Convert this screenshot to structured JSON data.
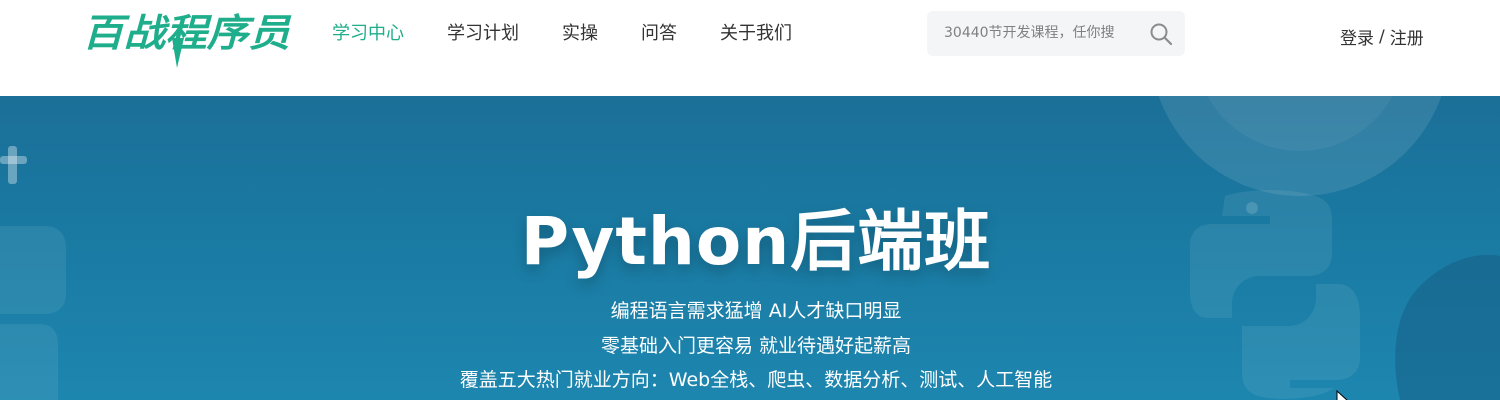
{
  "brand": {
    "logo_text": "百战程序员",
    "color": "#1fae8b"
  },
  "nav": {
    "items": [
      {
        "label": "学习中心",
        "active": true
      },
      {
        "label": "学习计划",
        "active": false
      },
      {
        "label": "实操",
        "active": false
      },
      {
        "label": "问答",
        "active": false
      },
      {
        "label": "关于我们",
        "active": false
      }
    ]
  },
  "search": {
    "placeholder": "30440节开发课程，任你搜",
    "icon": "search-icon"
  },
  "auth": {
    "login_label": "登录",
    "separator": "/",
    "register_label": "注册"
  },
  "banner": {
    "title": "Python后端班",
    "lines": [
      "编程语言需求猛增 AI人才缺口明显",
      "零基础入门更容易 就业待遇好起薪高",
      "覆盖五大热门就业方向：Web全栈、爬虫、数据分析、测试、人工智能"
    ],
    "background_color": "#1b77a0"
  }
}
